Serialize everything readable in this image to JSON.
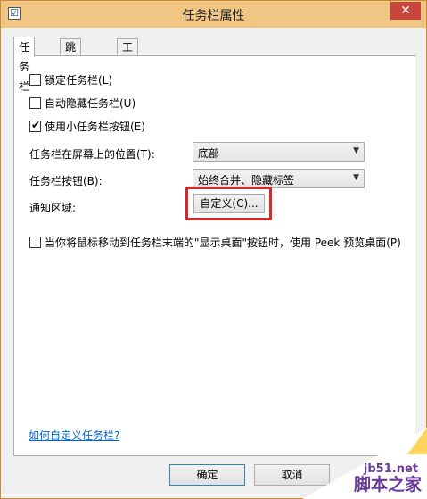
{
  "window": {
    "title": "任务栏属性",
    "close_label": "✕",
    "app_icon": "☑"
  },
  "tabs": [
    {
      "label": "任务栏",
      "active": true
    },
    {
      "label": "跳转列表",
      "active": false
    },
    {
      "label": "工具栏",
      "active": false
    }
  ],
  "options": {
    "lock": {
      "label": "锁定任务栏(L)",
      "checked": false
    },
    "autohide": {
      "label": "自动隐藏任务栏(U)",
      "checked": false
    },
    "small_buttons": {
      "label": "使用小任务栏按钮(E)",
      "checked": true
    }
  },
  "position": {
    "label": "任务栏在屏幕上的位置(T):",
    "value": "底部"
  },
  "buttons_mode": {
    "label": "任务栏按钮(B):",
    "value": "始终合并、隐藏标签"
  },
  "notification": {
    "label": "通知区域:",
    "button": "自定义(C)..."
  },
  "peek": {
    "label": "当你将鼠标移动到任务栏末端的\"显示桌面\"按钮时，使用 Peek 预览桌面(P)",
    "checked": false
  },
  "help_link": "如何自定义任务栏?",
  "footer": {
    "ok": "确定",
    "cancel": "取消"
  },
  "watermark": {
    "site": "jb51.net",
    "brand": "脚本之家"
  },
  "colors": {
    "title_bar": "#f1c684",
    "highlight": "#d22b2b",
    "link": "#0066cc"
  }
}
